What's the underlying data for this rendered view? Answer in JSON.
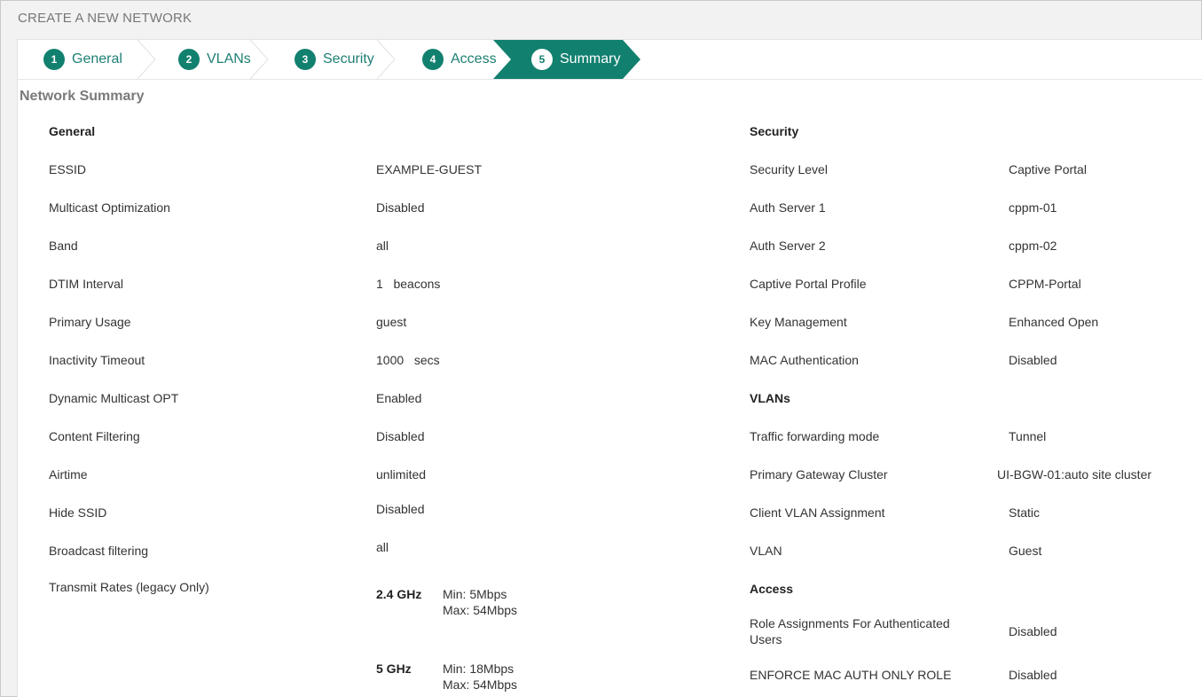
{
  "page": {
    "title": "CREATE A NEW NETWORK"
  },
  "wizard": {
    "steps": [
      {
        "num": "1",
        "label": "General"
      },
      {
        "num": "2",
        "label": "VLANs"
      },
      {
        "num": "3",
        "label": "Security"
      },
      {
        "num": "4",
        "label": "Access"
      },
      {
        "num": "5",
        "label": "Summary"
      }
    ],
    "active_step": "Summary",
    "accent": "#12806f"
  },
  "summary": {
    "title": "Network Summary",
    "general": {
      "heading": "General",
      "rows": [
        {
          "label": "ESSID",
          "value": "EXAMPLE-GUEST"
        },
        {
          "label": "Multicast Optimization",
          "value": "Disabled"
        },
        {
          "label": "Band",
          "value": "all"
        },
        {
          "label": "DTIM Interval",
          "value": "1   beacons"
        },
        {
          "label": "Primary Usage",
          "value": "guest"
        },
        {
          "label": "Inactivity Timeout",
          "value": "1000   secs"
        },
        {
          "label": "Dynamic Multicast OPT",
          "value": "Enabled"
        },
        {
          "label": "Content Filtering",
          "value": "Disabled"
        },
        {
          "label": "Airtime",
          "value": "unlimited"
        },
        {
          "label": "Hide SSID",
          "value": "Disabled"
        },
        {
          "label": "Broadcast filtering",
          "value": "all"
        }
      ],
      "transmit_rates": {
        "label": "Transmit Rates (legacy Only)",
        "bands": [
          {
            "band": "2.4 GHz",
            "min": "Min:  5Mbps",
            "max": "Max:  54Mbps"
          },
          {
            "band": "5 GHz",
            "min": "Min:  18Mbps",
            "max": "Max:  54Mbps"
          }
        ]
      }
    },
    "security": {
      "heading": "Security",
      "rows": [
        {
          "label": "Security Level",
          "value": "Captive Portal"
        },
        {
          "label": "Auth Server 1",
          "value": "cppm-01"
        },
        {
          "label": "Auth Server 2",
          "value": "cppm-02"
        },
        {
          "label": "Captive Portal Profile",
          "value": "CPPM-Portal"
        },
        {
          "label": "Key Management",
          "value": "Enhanced Open"
        },
        {
          "label": "MAC Authentication",
          "value": "Disabled"
        }
      ]
    },
    "vlans": {
      "heading": "VLANs",
      "rows": [
        {
          "label": "Traffic forwarding mode",
          "value": "Tunnel"
        },
        {
          "label": "Primary Gateway Cluster",
          "value": "UI-BGW-01:auto site cluster"
        },
        {
          "label": "Client VLAN Assignment",
          "value": "Static"
        },
        {
          "label": "VLAN",
          "value": "Guest"
        }
      ]
    },
    "access": {
      "heading": "Access",
      "rows": [
        {
          "label": "Role Assignments For Authenticated Users",
          "value": "Disabled"
        },
        {
          "label": "ENFORCE MAC AUTH ONLY ROLE",
          "value": "Disabled"
        }
      ]
    }
  }
}
